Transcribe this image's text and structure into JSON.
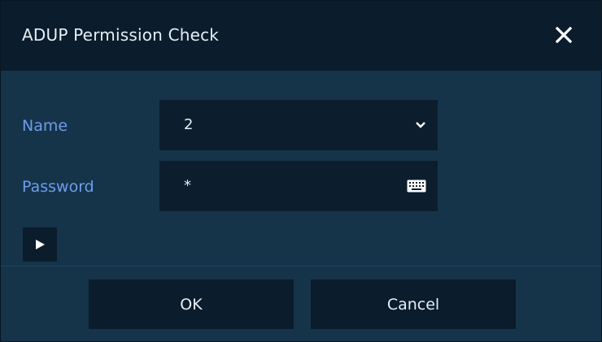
{
  "dialog": {
    "title": "ADUP Permission Check",
    "close_icon": "close-icon"
  },
  "form": {
    "name_label": "Name",
    "name_value": "2",
    "name_icon": "chevron-down-icon",
    "password_label": "Password",
    "password_value": "*",
    "password_icon": "keyboard-icon",
    "expand_icon": "play-triangle-icon"
  },
  "buttons": {
    "ok_label": "OK",
    "cancel_label": "Cancel"
  },
  "colors": {
    "panel": "#15344a",
    "titlebar": "#0b1c2c",
    "field": "#0c1d2d",
    "label": "#6f9ce9",
    "text": "#e6eef5"
  }
}
